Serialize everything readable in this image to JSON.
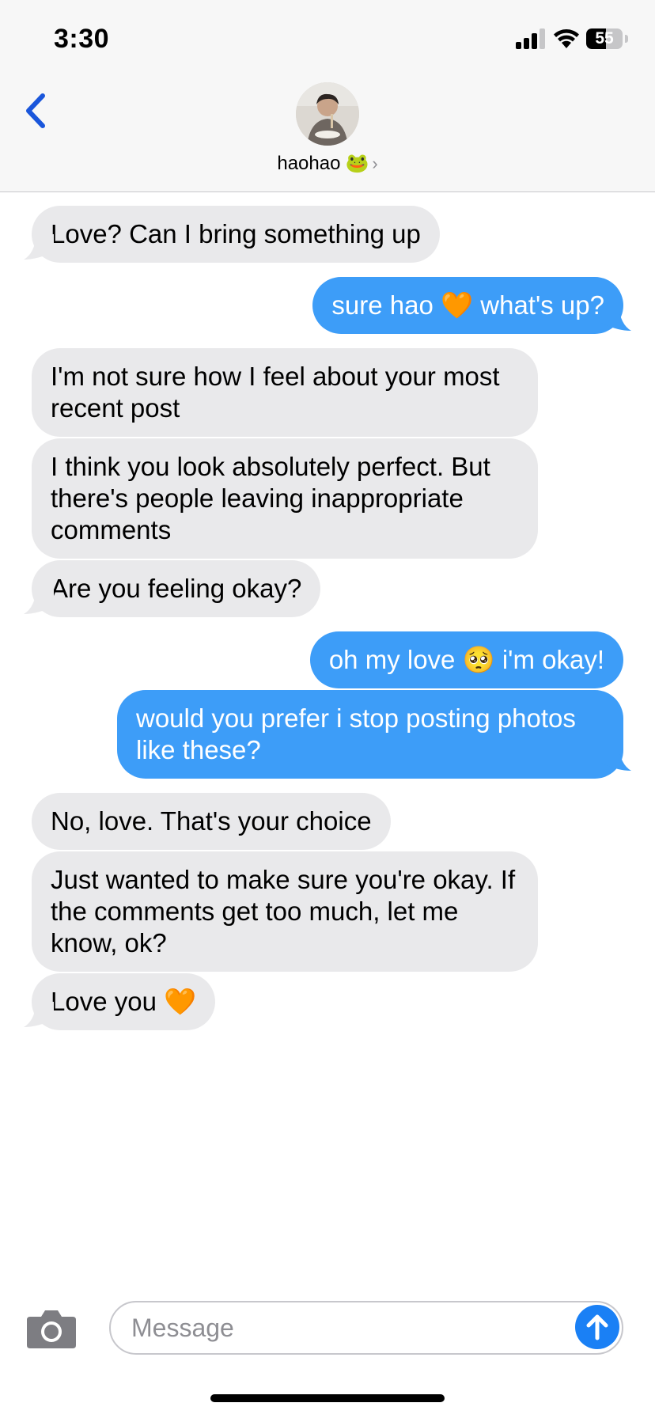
{
  "status_bar": {
    "time": "3:30",
    "battery_level": "55",
    "battery_fraction": 0.55,
    "signal_bars": 3
  },
  "header": {
    "contact_name": "haohao",
    "contact_emoji": "🐸",
    "chevron": "›"
  },
  "messages": [
    {
      "direction": "in",
      "text": "Love? Can I bring something up"
    },
    {
      "direction": "out",
      "text": "sure hao 🧡 what's up?"
    },
    {
      "direction": "in",
      "text": "I'm not sure how I feel about your most recent post"
    },
    {
      "direction": "in",
      "text": "I think you look absolutely perfect. But there's people leaving inappropriate comments"
    },
    {
      "direction": "in",
      "text": "Are you feeling okay?"
    },
    {
      "direction": "out",
      "text": "oh my love 🥺 i'm okay!"
    },
    {
      "direction": "out",
      "text": "would you prefer i stop posting photos like these?"
    },
    {
      "direction": "in",
      "text": "No, love. That's your choice"
    },
    {
      "direction": "in",
      "text": "Just wanted to make sure you're okay. If the comments get too much, let me know, ok?"
    },
    {
      "direction": "in",
      "text": "Love you 🧡"
    }
  ],
  "composer": {
    "placeholder": "Message"
  },
  "colors": {
    "incoming_bubble": "#e9e9eb",
    "outgoing_bubble": "#3d9df8",
    "accent": "#1a80f5",
    "header_bg": "#f7f7f7"
  },
  "icons": {
    "back": "chevron-left-icon",
    "camera": "camera-icon",
    "send": "arrow-up-icon",
    "signal": "cellular-signal-icon",
    "wifi": "wifi-icon",
    "battery": "battery-icon"
  }
}
